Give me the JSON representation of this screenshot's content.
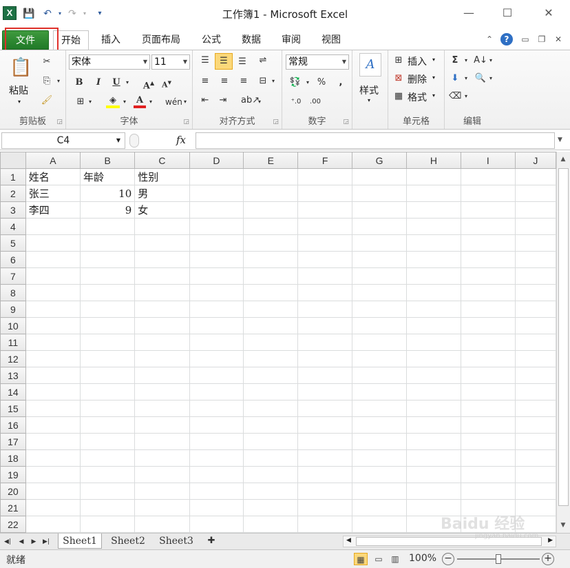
{
  "window": {
    "title": "工作簿1 - Microsoft Excel"
  },
  "tabs": [
    "文件",
    "开始",
    "插入",
    "页面布局",
    "公式",
    "数据",
    "审阅",
    "视图"
  ],
  "clipboard": {
    "paste": "粘贴",
    "label": "剪贴板"
  },
  "font": {
    "name": "宋体",
    "size": "11",
    "label": "字体"
  },
  "alignment": {
    "label": "对齐方式"
  },
  "number": {
    "format": "常规",
    "percent": "%",
    "comma": ",",
    "label": "数字"
  },
  "styles": {
    "label": "样式"
  },
  "cells": {
    "insert": "插入",
    "delete": "删除",
    "format": "格式",
    "label": "单元格"
  },
  "editing": {
    "label": "编辑",
    "sum": "Σ"
  },
  "formula_bar": {
    "cell_ref": "C4",
    "fx": "fx",
    "value": ""
  },
  "grid": {
    "columns": [
      "A",
      "B",
      "C",
      "D",
      "E",
      "F",
      "G",
      "H",
      "I",
      "J"
    ],
    "rows": [
      [
        "姓名",
        "年龄",
        "性别"
      ],
      [
        "张三",
        "10",
        "男"
      ],
      [
        "李四",
        "9",
        "女"
      ]
    ],
    "row_count": 22
  },
  "sheets": [
    "Sheet1",
    "Sheet2",
    "Sheet3"
  ],
  "status": {
    "ready": "就绪",
    "zoom": "100%"
  },
  "watermark": {
    "text": "Baidu 经验",
    "url": "jingyan.baidu.com"
  },
  "colors": {
    "file_tab": "#2f8a34",
    "highlight": "#e0302a",
    "excel": "#1e7145"
  }
}
